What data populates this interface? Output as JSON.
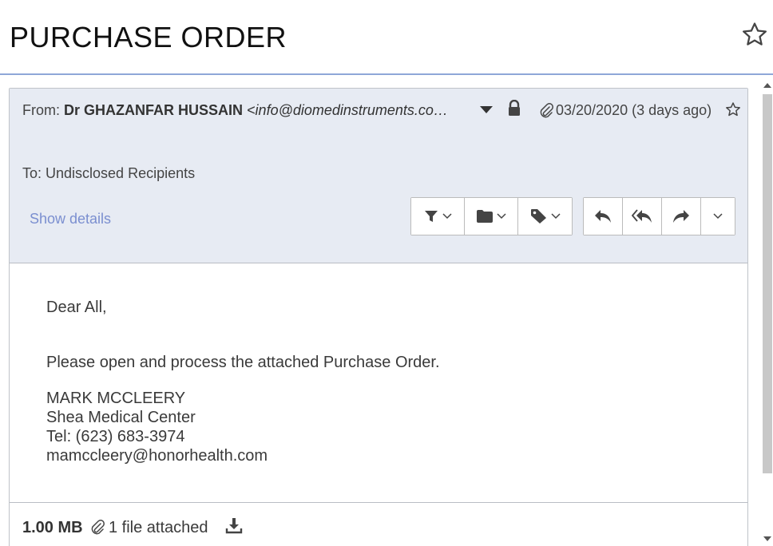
{
  "title": "PURCHASE ORDER",
  "header": {
    "from_label": "From:",
    "sender_name": "Dr GHAZANFAR HUSSAIN",
    "sender_email": "<info@diomedinstruments.co…",
    "date": "03/20/2020 (3 days ago)",
    "to_text": "To: Undisclosed Recipients",
    "show_details": "Show details"
  },
  "toolbar": {
    "group1": [
      "filter-icon",
      "folder-icon",
      "tag-icon"
    ],
    "group2": [
      "reply-icon",
      "reply-all-icon",
      "forward-icon",
      "more-chevron-icon"
    ]
  },
  "body": {
    "greeting": "Dear All,",
    "line1": "Please open and process the attached Purchase Order.",
    "signature": [
      "MARK MCCLEERY",
      "Shea Medical Center",
      "Tel: (623) 683-3974",
      "mamccleery@honorhealth.com"
    ]
  },
  "footer": {
    "size": "1.00 MB",
    "attached": "1 file attached"
  },
  "colors": {
    "header_bg": "#e7ebf3",
    "link": "#7b8fd0",
    "title_rule": "#8fa7d8"
  }
}
